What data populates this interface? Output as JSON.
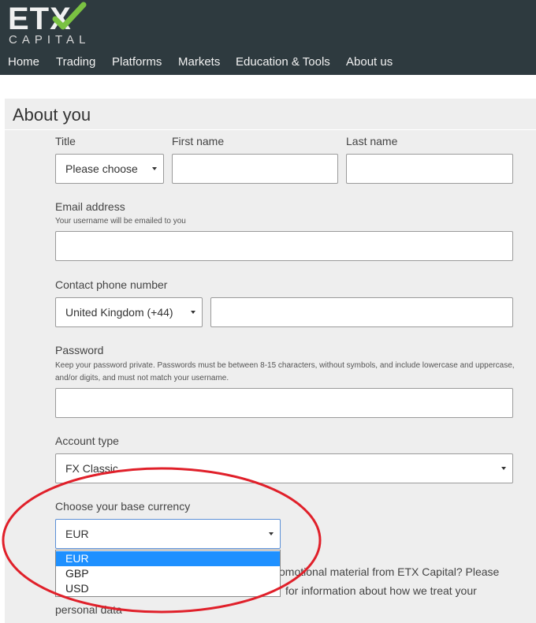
{
  "brand": {
    "logo_main": "ETX",
    "logo_sub": "CAPITAL",
    "accent": "#7ac142"
  },
  "nav": {
    "items": [
      "Home",
      "Trading",
      "Platforms",
      "Markets",
      "Education & Tools",
      "About us"
    ]
  },
  "form": {
    "section_title": "About you",
    "title": {
      "label": "Title",
      "value": "Please choose"
    },
    "first_name": {
      "label": "First name",
      "value": ""
    },
    "last_name": {
      "label": "Last name",
      "value": ""
    },
    "email": {
      "label": "Email address",
      "hint": "Your username will be emailed to you",
      "value": ""
    },
    "phone": {
      "label": "Contact phone number",
      "country": "United Kingdom (+44)",
      "value": ""
    },
    "password": {
      "label": "Password",
      "hint": "Keep your password private. Passwords must be between 8-15 characters, without symbols, and include lowercase and uppercase, and/or digits, and must not match your username.",
      "value": ""
    },
    "account_type": {
      "label": "Account type",
      "value": "FX Classic"
    },
    "currency": {
      "label": "Choose your base currency",
      "value": "EUR",
      "options": [
        "EUR",
        "GBP",
        "USD"
      ],
      "highlighted": "EUR"
    },
    "marketing": {
      "line1": "omotional material from ETX Capital? Please",
      "line2": "for information about how we treat your",
      "line3": "personal data"
    }
  },
  "colors": {
    "header_bg": "#2e3a3f",
    "panel_bg": "#eeeeee",
    "highlight": "#1e90ff",
    "annotation": "#e0202a"
  }
}
